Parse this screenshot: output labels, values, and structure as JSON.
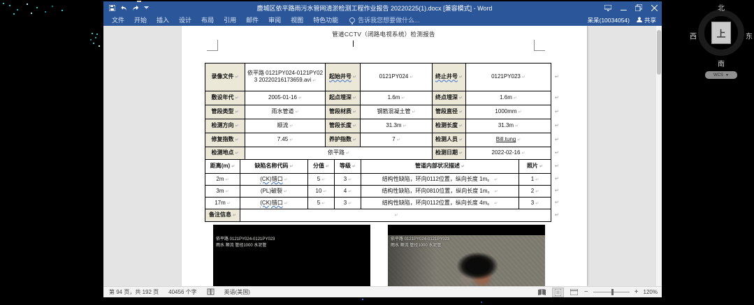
{
  "window": {
    "title": "鹿城区依平路雨污水管网清淤检测工程作业报告 20220225(1).docx [兼容模式] - Word",
    "tabs": [
      "文件",
      "开始",
      "插入",
      "设计",
      "布局",
      "引用",
      "邮件",
      "审阅",
      "视图",
      "特色功能"
    ],
    "tell_me": "告诉我您想要做什么...",
    "user": "呆呆(10034054)",
    "share_label": "共享"
  },
  "document": {
    "heading": "管道CCTV（闭路电视系统）检测报告",
    "info_table": {
      "rows": [
        [
          {
            "t": "录像文件",
            "l": 1
          },
          {
            "t": "依平路 0121PY024-0121PY023 20220216173659.avi"
          },
          {
            "t": "起始井号",
            "l": 1,
            "u": "sq"
          },
          {
            "t": "0121PY024"
          },
          {
            "t": "终止井号",
            "l": 1,
            "u": "sq"
          },
          {
            "t": "0121PY023"
          }
        ],
        [
          {
            "t": "敷设年代",
            "l": 1
          },
          {
            "t": "2005-01-16"
          },
          {
            "t": "起点埋深",
            "l": 1
          },
          {
            "t": "1.6m"
          },
          {
            "t": "终点埋深",
            "l": 1
          },
          {
            "t": "1.6m"
          }
        ],
        [
          {
            "t": "管段类型",
            "l": 1
          },
          {
            "t": "雨水管道"
          },
          {
            "t": "管段材质",
            "l": 1
          },
          {
            "t": "钢筋混凝土管"
          },
          {
            "t": "管段直径",
            "l": 1
          },
          {
            "t": "1000mm"
          }
        ],
        [
          {
            "t": "检测方向",
            "l": 1
          },
          {
            "t": "顺流"
          },
          {
            "t": "管段长度",
            "l": 1
          },
          {
            "t": "31.3m"
          },
          {
            "t": "检测长度",
            "l": 1
          },
          {
            "t": "31.3m"
          }
        ],
        [
          {
            "t": "修复指数",
            "l": 1
          },
          {
            "t": "7.45"
          },
          {
            "t": "养护指数",
            "l": 1
          },
          {
            "t": "7"
          },
          {
            "t": "检测人员",
            "l": 1
          },
          {
            "t": "Bill.tung",
            "u": "ln"
          }
        ],
        [
          {
            "t": "检测地点",
            "l": 1
          },
          {
            "t": "依平路",
            "c": 3
          },
          {
            "t": "检测日期",
            "l": 1
          },
          {
            "t": "2022-02-16"
          }
        ]
      ]
    },
    "defect_table": {
      "headers": [
        "距离(m)",
        "缺陷名称代码",
        "分值",
        "等级",
        "管道内部状况描述",
        "照片"
      ],
      "rows": [
        [
          {
            "t": "2m"
          },
          {
            "t": "(CK)错口",
            "u": "sq"
          },
          {
            "t": "5"
          },
          {
            "t": "3"
          },
          {
            "t": "结构性缺陷，环向0112位置，纵向长度 1m。",
            "d": 1
          },
          {
            "t": "1"
          }
        ],
        [
          {
            "t": "3m"
          },
          {
            "t": "(PL)破裂"
          },
          {
            "t": "10"
          },
          {
            "t": "4"
          },
          {
            "t": "结构性缺陷，环向0810位置，纵向长度 1m。",
            "d": 1
          },
          {
            "t": "2"
          }
        ],
        [
          {
            "t": "17m"
          },
          {
            "t": "(CK)错口",
            "u": "sq"
          },
          {
            "t": "5"
          },
          {
            "t": "3"
          },
          {
            "t": "结构性缺陷，环向0112位置，纵向长度 4m。",
            "d": 1
          },
          {
            "t": "3"
          }
        ]
      ],
      "remark_label": "备注信息"
    },
    "photos": [
      {
        "caption_line1": "依平路 0121PY024-0121PY023",
        "caption_line2": "雨水  顺流  管径1000  水泥管"
      },
      {
        "caption_line1": "依平路 0121PY024-0121PY023",
        "caption_line2": "雨水  顺流  管径1000  水泥管"
      }
    ]
  },
  "status_bar": {
    "page_info": "第 94 页，共 192 页",
    "word_count": "40456 个字",
    "language": "英语(美国)",
    "zoom_level": "120%"
  },
  "compass": {
    "north": "北",
    "south": "南",
    "west": "西",
    "east": "东",
    "center": "上",
    "pill": "WCS"
  },
  "symbols": {
    "para_mark": "↵",
    "cell_mark": "↵"
  },
  "colors": {
    "titlebar": "#2b579a",
    "label_cell": "#ece8d8",
    "page": "#ffffff",
    "desktop": "#000000"
  }
}
